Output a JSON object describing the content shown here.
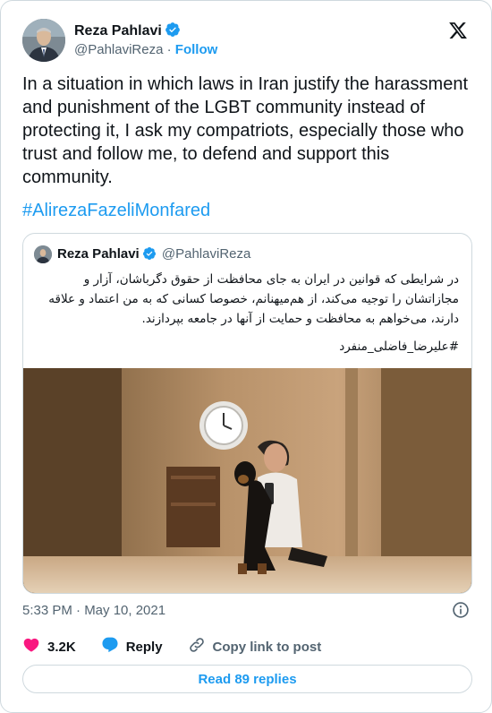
{
  "author": {
    "name": "Reza Pahlavi",
    "handle": "@PahlaviReza",
    "separator": "·",
    "follow_label": "Follow"
  },
  "tweet": {
    "text": "In a situation in which laws in Iran justify the harassment and punishment of the LGBT community instead of protecting it, I ask my compatriots, especially those who trust and follow me, to defend and support this community.",
    "hashtag": "#AlirezaFazeliMonfared"
  },
  "quoted": {
    "name": "Reza Pahlavi",
    "handle": "@PahlaviReza",
    "text": "در شرایطی که قوانین در ایران به جای محافظت از حقوق دگرباشان، آزار و مجازاتشان را توجیه می‌کند، از هم‌میهنانم، خصوصا کسانی که به من اعتماد و علاقه دارند، می‌خواهم به محافظت و حمایت از آنها در جامعه بپردازند.",
    "hashtag": "#علیرضا_فاضلی_منفرد"
  },
  "meta": {
    "timestamp": "5:33 PM · May 10, 2021"
  },
  "actions": {
    "likes": "3.2K",
    "reply_label": "Reply",
    "copy_label": "Copy link to post"
  },
  "footer": {
    "read_replies": "Read 89 replies"
  },
  "colors": {
    "accent": "#1d9bf0",
    "heart": "#f91880",
    "muted": "#536471",
    "text": "#0f1419"
  }
}
